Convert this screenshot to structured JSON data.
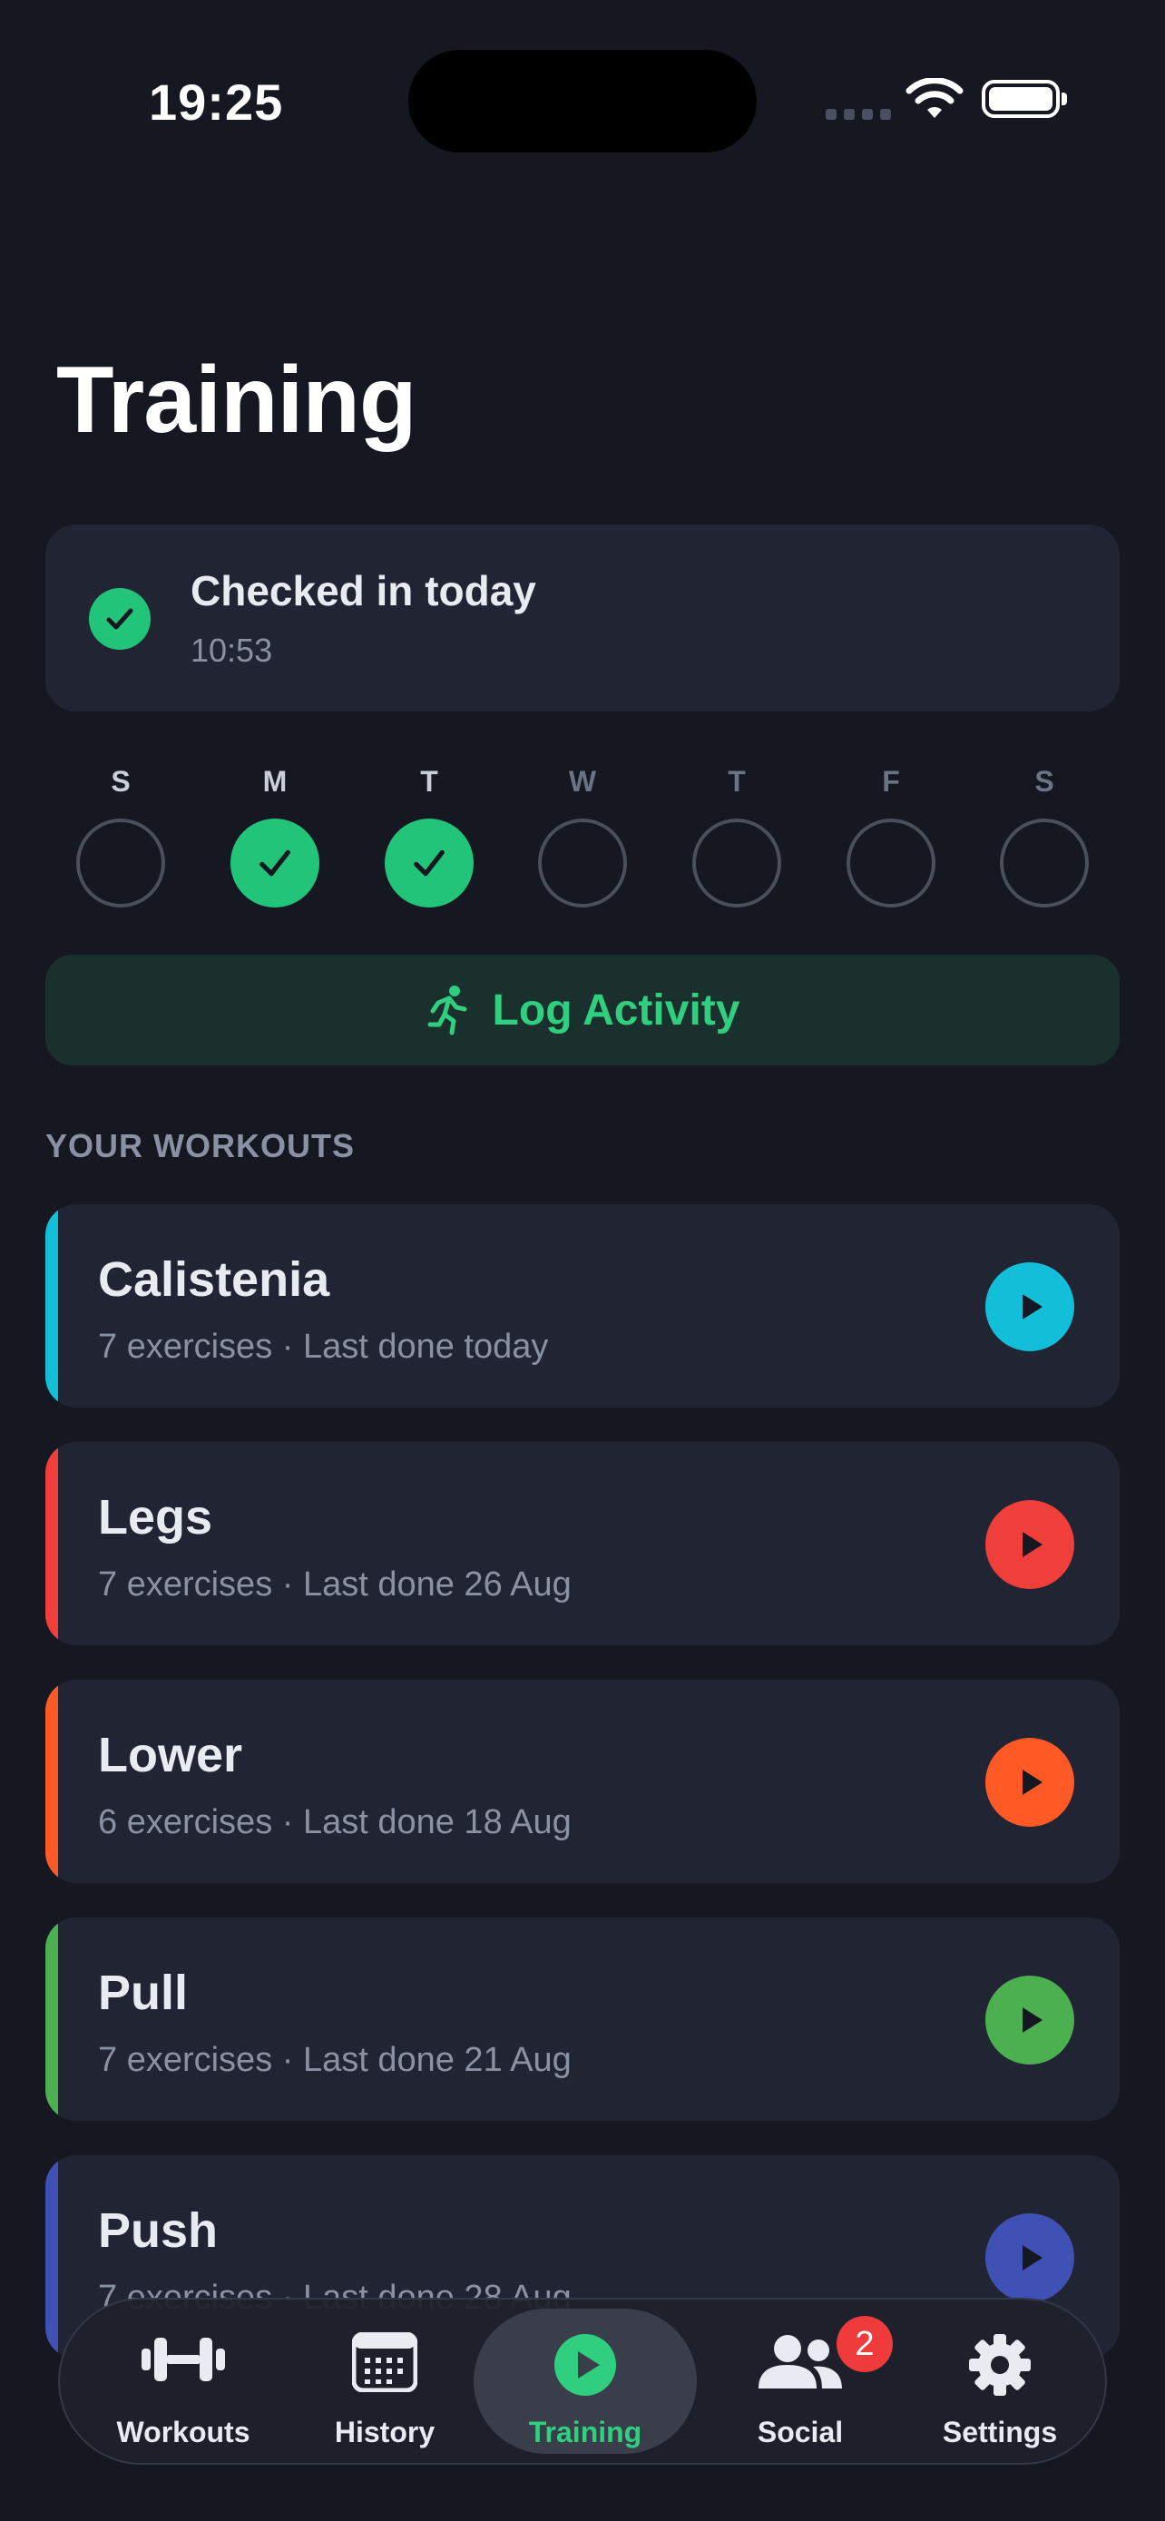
{
  "status_bar": {
    "time": "19:25"
  },
  "page": {
    "title": "Training"
  },
  "checkin": {
    "title": "Checked in today",
    "time": "10:53",
    "accent": "#22c47a"
  },
  "week": [
    {
      "letter": "S",
      "done": false,
      "highlight": true
    },
    {
      "letter": "M",
      "done": true,
      "highlight": true
    },
    {
      "letter": "T",
      "done": true,
      "highlight": true
    },
    {
      "letter": "W",
      "done": false,
      "highlight": false
    },
    {
      "letter": "T",
      "done": false,
      "highlight": false
    },
    {
      "letter": "F",
      "done": false,
      "highlight": false
    },
    {
      "letter": "S",
      "done": false,
      "highlight": false
    }
  ],
  "log_activity": {
    "label": "Log Activity",
    "icon": "running-person-icon"
  },
  "workouts_section": {
    "label": "YOUR WORKOUTS",
    "items": [
      {
        "name": "Calistenia",
        "meta": "7 exercises · Last done today",
        "color": "#13bfd8"
      },
      {
        "name": "Legs",
        "meta": "7 exercises · Last done 26 Aug",
        "color": "#f03e3a"
      },
      {
        "name": "Lower",
        "meta": "6 exercises · Last done 18 Aug",
        "color": "#ff5a26"
      },
      {
        "name": "Pull",
        "meta": "7 exercises · Last done 21 Aug",
        "color": "#4caf50"
      },
      {
        "name": "Push",
        "meta": "7 exercises · Last done 28 Aug",
        "color": "#3f51b5"
      }
    ]
  },
  "tabbar": {
    "tabs": [
      {
        "label": "Workouts",
        "icon": "dumbbell-icon"
      },
      {
        "label": "History",
        "icon": "calendar-icon"
      },
      {
        "label": "Training",
        "icon": "play-circle-icon",
        "active": true
      },
      {
        "label": "Social",
        "icon": "people-icon",
        "badge": "2"
      },
      {
        "label": "Settings",
        "icon": "gear-icon"
      }
    ]
  }
}
